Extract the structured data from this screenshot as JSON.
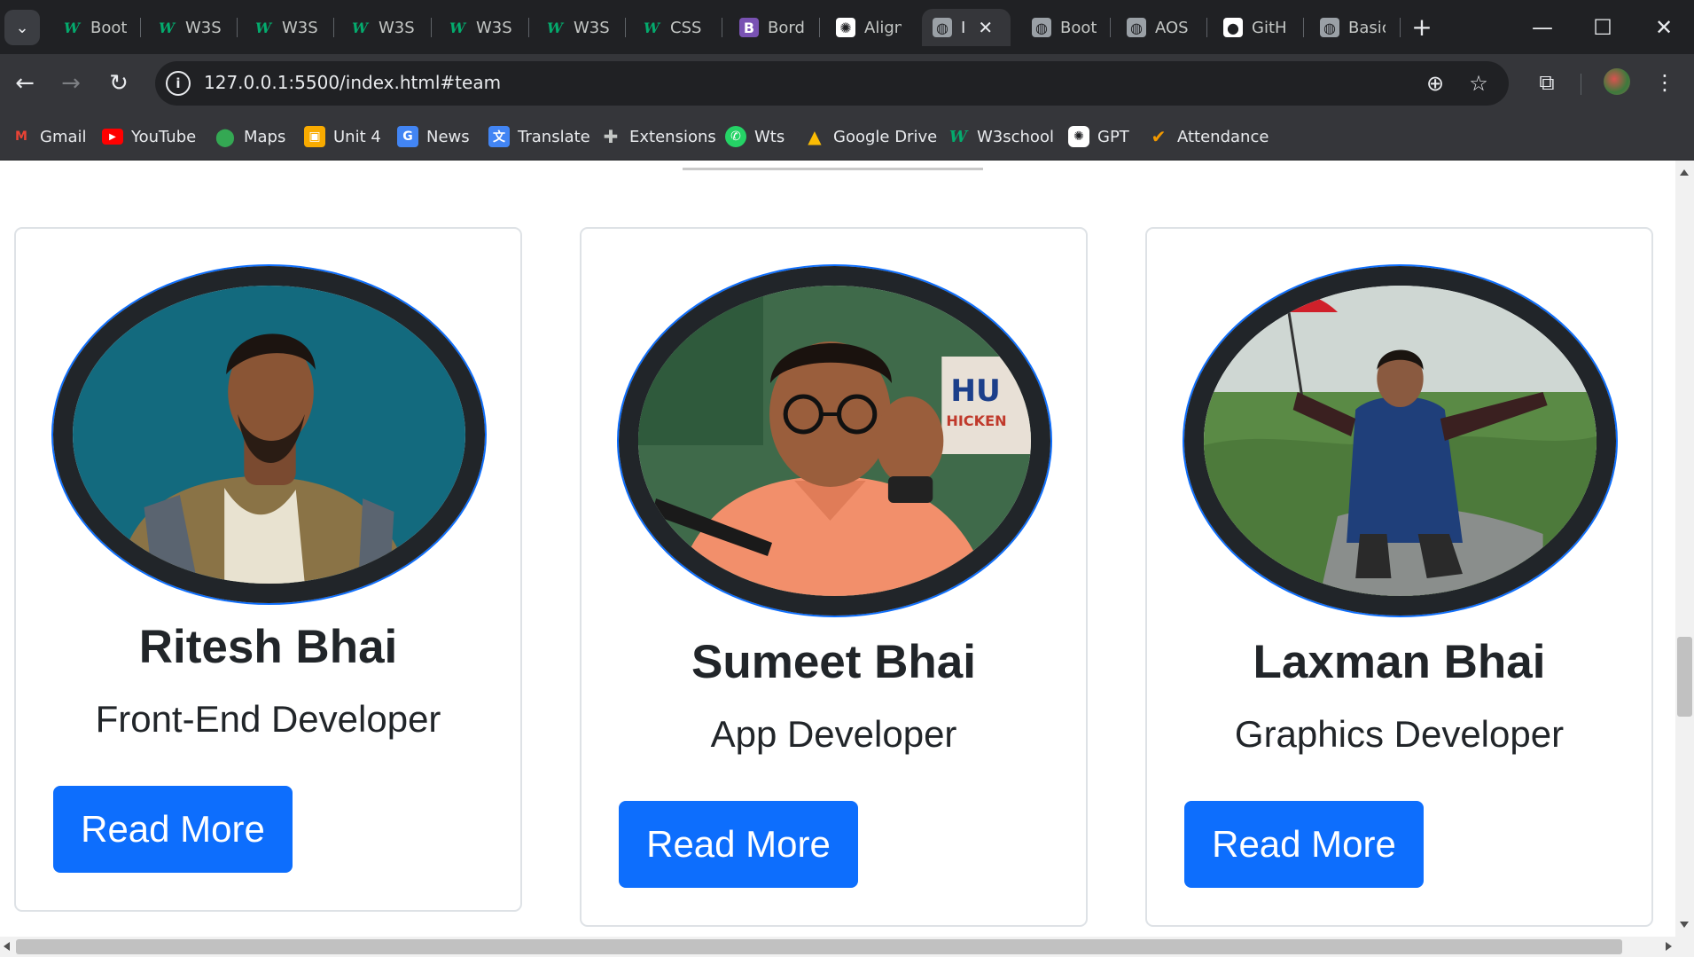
{
  "browser": {
    "tab_search_icon": "chevron-down-icon",
    "tabs": [
      {
        "title": "Boot",
        "favicon": "w3schools-icon"
      },
      {
        "title": "W3S",
        "favicon": "w3schools-icon"
      },
      {
        "title": "W3S",
        "favicon": "w3schools-icon"
      },
      {
        "title": "W3S",
        "favicon": "w3schools-icon"
      },
      {
        "title": "W3S",
        "favicon": "w3schools-icon"
      },
      {
        "title": "W3S",
        "favicon": "w3schools-icon"
      },
      {
        "title": "CSS",
        "favicon": "w3schools-icon"
      },
      {
        "title": "Bord",
        "favicon": "bootstrap-icon"
      },
      {
        "title": "Align",
        "favicon": "chatgpt-icon"
      },
      {
        "title": "I",
        "favicon": "globe-icon",
        "active": true
      },
      {
        "title": "Boot",
        "favicon": "globe-icon"
      },
      {
        "title": "AOS",
        "favicon": "globe-icon"
      },
      {
        "title": "GitH",
        "favicon": "github-icon"
      },
      {
        "title": "Basic",
        "favicon": "globe-icon"
      }
    ],
    "new_tab_icon": "plus-icon",
    "window_controls": [
      "minimize-icon",
      "maximize-icon",
      "close-icon"
    ],
    "url": "127.0.0.1:5500/index.html#team",
    "bookmarks": [
      {
        "label": "Gmail",
        "icon": "gmail-icon",
        "color": "#ea4335"
      },
      {
        "label": "YouTube",
        "icon": "youtube-icon",
        "color": "#ff0000"
      },
      {
        "label": "Maps",
        "icon": "maps-icon",
        "color": "#34a853"
      },
      {
        "label": "Unit 4",
        "icon": "classroom-icon",
        "color": "#f9ab00"
      },
      {
        "label": "News",
        "icon": "news-icon",
        "color": "#4285f4"
      },
      {
        "label": "Translate",
        "icon": "translate-icon",
        "color": "#4285f4"
      },
      {
        "label": "Extensions",
        "icon": "puzzle-icon",
        "color": "#9aa0a6"
      },
      {
        "label": "Wts",
        "icon": "whatsapp-icon",
        "color": "#25d366"
      },
      {
        "label": "Google Drive",
        "icon": "drive-icon",
        "color": "#fbbc04"
      },
      {
        "label": "W3school",
        "icon": "w3schools-icon",
        "color": "#04aa6d"
      },
      {
        "label": "GPT",
        "icon": "chatgpt-icon",
        "color": "#ffffff"
      },
      {
        "label": "Attendance",
        "icon": "attendance-icon",
        "color": "#f29900"
      }
    ]
  },
  "page": {
    "accent_color": "#0d6efd",
    "team": [
      {
        "name": "Ritesh Bhai",
        "role": "Front-End Developer",
        "button": "Read More"
      },
      {
        "name": "Sumeet Bhai",
        "role": "App Developer",
        "button": "Read More"
      },
      {
        "name": "Laxman Bhai",
        "role": "Graphics Developer",
        "button": "Read More"
      }
    ]
  }
}
